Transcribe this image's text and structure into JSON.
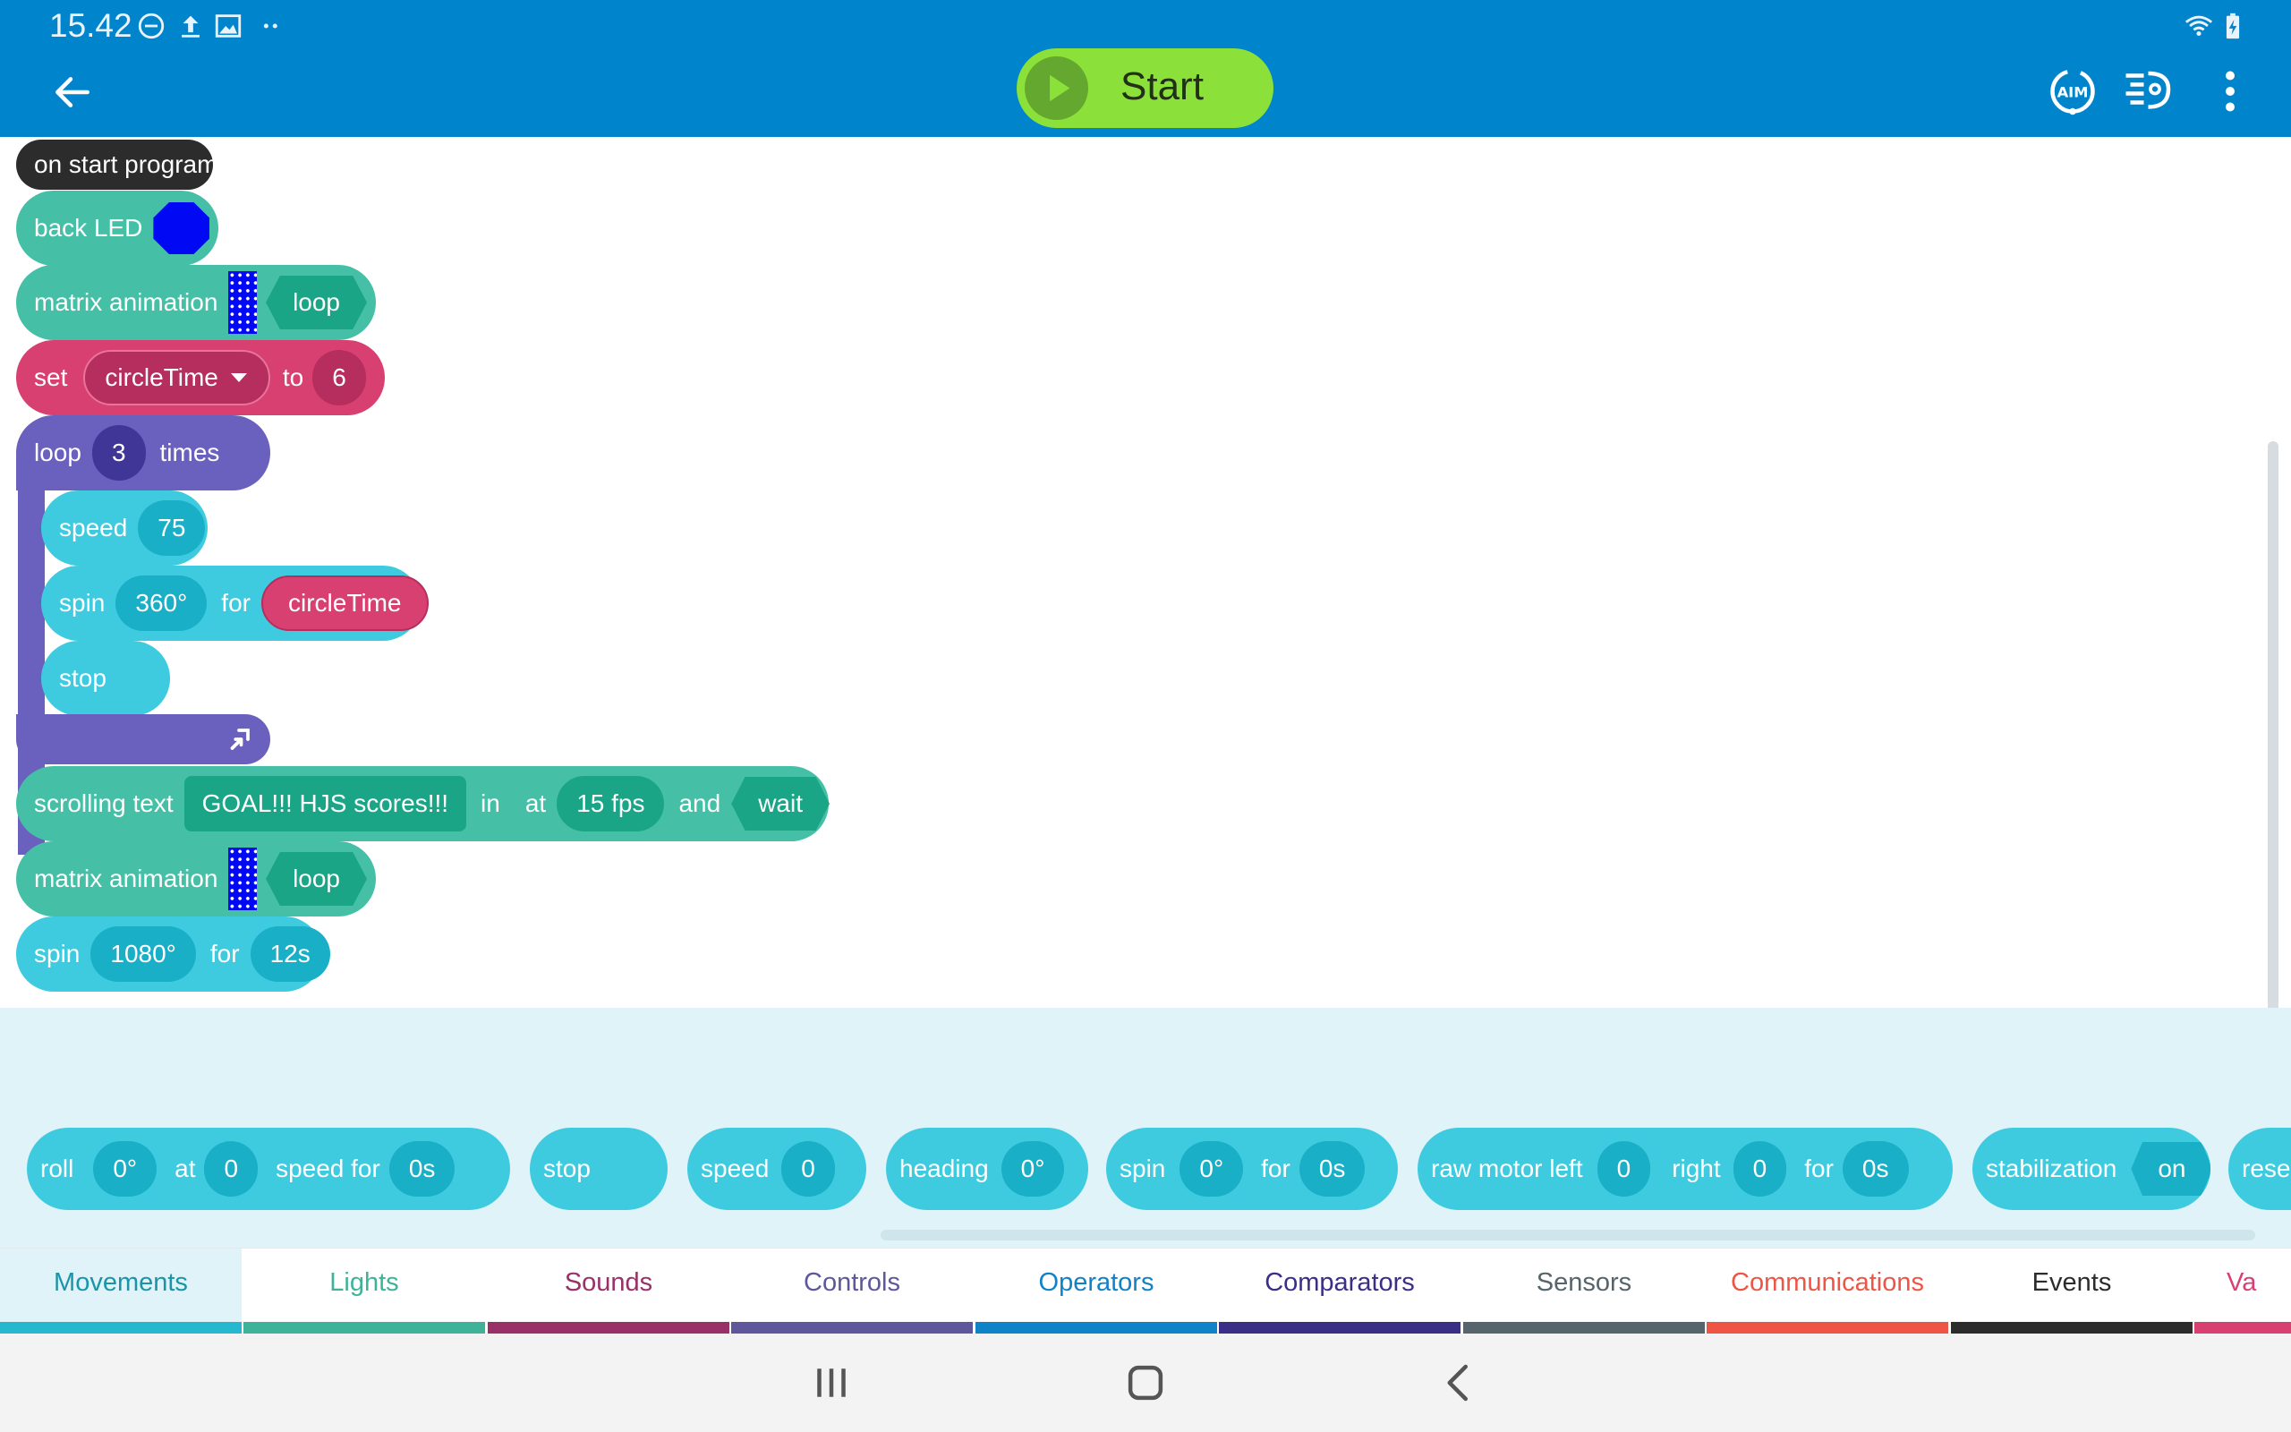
{
  "status_bar": {
    "time": "15.42",
    "icons": [
      "do-not-disturb-icon",
      "upload-icon",
      "image-icon",
      "more-dots-icon",
      "wifi-icon",
      "battery-charging-icon"
    ]
  },
  "app_bar": {
    "start_label": "Start",
    "icons": [
      "back-arrow-icon",
      "aim-icon",
      "program-settings-icon",
      "more-vert-icon"
    ]
  },
  "program": {
    "on_start": "on start program",
    "back_led": {
      "label": "back LED",
      "color": "#0008f4"
    },
    "matrix1": {
      "label": "matrix animation",
      "mode": "loop"
    },
    "set": {
      "label": "set",
      "variable": "circleTime",
      "to": "to",
      "value": "6"
    },
    "loop": {
      "label": "loop",
      "count": "3",
      "times": "times"
    },
    "speed": {
      "label": "speed",
      "value": "75"
    },
    "spin1": {
      "label": "spin",
      "angle": "360°",
      "for": "for",
      "duration": "circleTime"
    },
    "stop": {
      "label": "stop"
    },
    "scrolling": {
      "label": "scrolling text",
      "text": "GOAL!!! HJS scores!!!",
      "in": "in",
      "at": "at",
      "fps": "15 fps",
      "and": "and",
      "wait": "wait"
    },
    "matrix2": {
      "label": "matrix animation",
      "mode": "loop"
    },
    "spin2": {
      "label": "spin",
      "angle": "1080°",
      "for": "for",
      "duration": "12s"
    }
  },
  "palette": {
    "roll": {
      "label": "roll",
      "angle": "0°",
      "at": "at",
      "speed": "0",
      "speed_for": "speed for",
      "duration": "0s"
    },
    "stop": {
      "label": "stop"
    },
    "speed": {
      "label": "speed",
      "value": "0"
    },
    "heading": {
      "label": "heading",
      "value": "0°"
    },
    "spin": {
      "label": "spin",
      "angle": "0°",
      "for": "for",
      "duration": "0s"
    },
    "raw_motor": {
      "label": "raw motor left",
      "left": "0",
      "right_label": "right",
      "right": "0",
      "for": "for",
      "duration": "0s"
    },
    "stabilization": {
      "label": "stabilization",
      "value": "on"
    },
    "reset": {
      "label": "rese"
    }
  },
  "tabs": [
    {
      "label": "Movements",
      "color": "#26b8cf",
      "text_color": "#1a94a8"
    },
    {
      "label": "Lights",
      "color": "#3fb39a",
      "text_color": "#3fb39a"
    },
    {
      "label": "Sounds",
      "color": "#9a3068",
      "text_color": "#9a3068"
    },
    {
      "label": "Controls",
      "color": "#5e579c",
      "text_color": "#5e579c"
    },
    {
      "label": "Operators",
      "color": "#1082c8",
      "text_color": "#1082c8"
    },
    {
      "label": "Comparators",
      "color": "#3a2e86",
      "text_color": "#3a2e86"
    },
    {
      "label": "Sensors",
      "color": "#56646b",
      "text_color": "#56646b"
    },
    {
      "label": "Communications",
      "color": "#ee5545",
      "text_color": "#ee5545"
    },
    {
      "label": "Events",
      "color": "#2c2c2c",
      "text_color": "#2c2c2c"
    },
    {
      "label": "Va",
      "color": "#d94072",
      "text_color": "#d94072"
    }
  ],
  "nav_bar": {
    "icons": [
      "recents-icon",
      "home-icon",
      "nav-back-icon"
    ]
  }
}
